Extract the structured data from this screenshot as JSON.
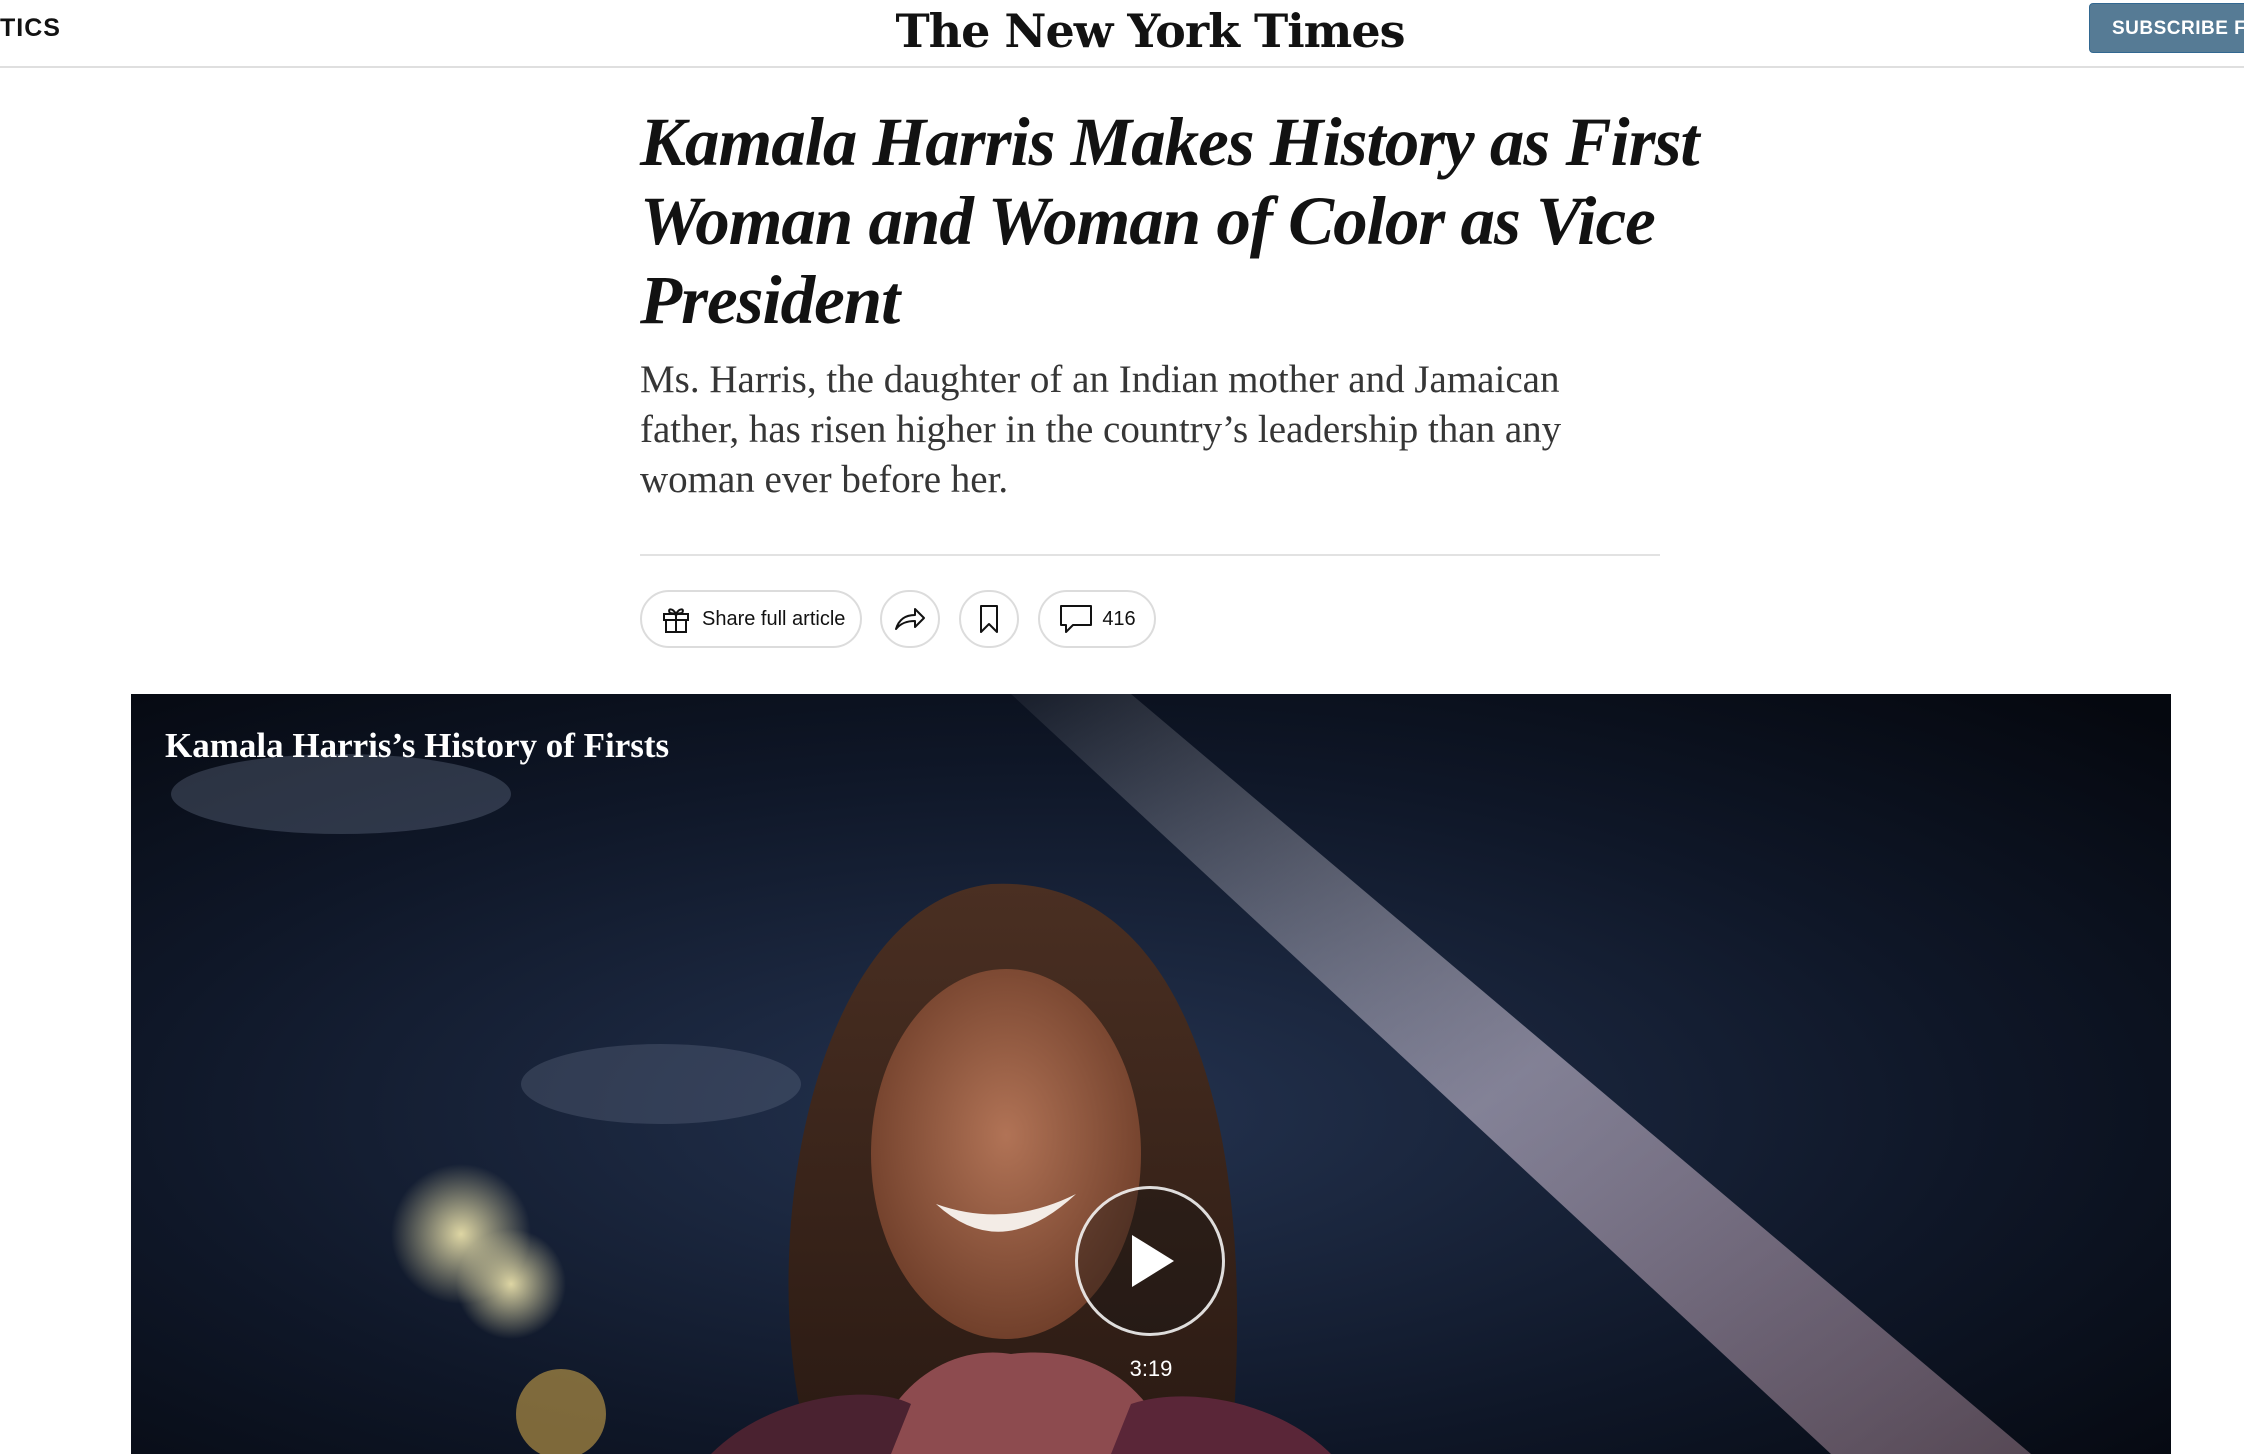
{
  "header": {
    "section_label": "TICS",
    "masthead": "The New York Times",
    "subscribe_label": "SUBSCRIBE FO"
  },
  "article": {
    "headline": "Kamala Harris Makes History as First Woman and Woman of Color as Vice President",
    "summary": "Ms. Harris, the daughter of an Indian mother and Jamaican father, has risen higher in the country’s leadership than any woman ever before her."
  },
  "toolbar": {
    "share_full_label": "Share full article",
    "comments_count": "416",
    "icons": {
      "gift": "gift-icon",
      "share": "share-icon",
      "bookmark": "bookmark-icon",
      "comment": "comment-icon"
    }
  },
  "video": {
    "title": "Kamala Harris’s History of Firsts",
    "duration": "3:19",
    "play_icon": "play-icon"
  },
  "colors": {
    "subscribe_bg": "#567b95",
    "text": "#121212",
    "summary_text": "#363636",
    "divider": "#e2e2e2"
  }
}
